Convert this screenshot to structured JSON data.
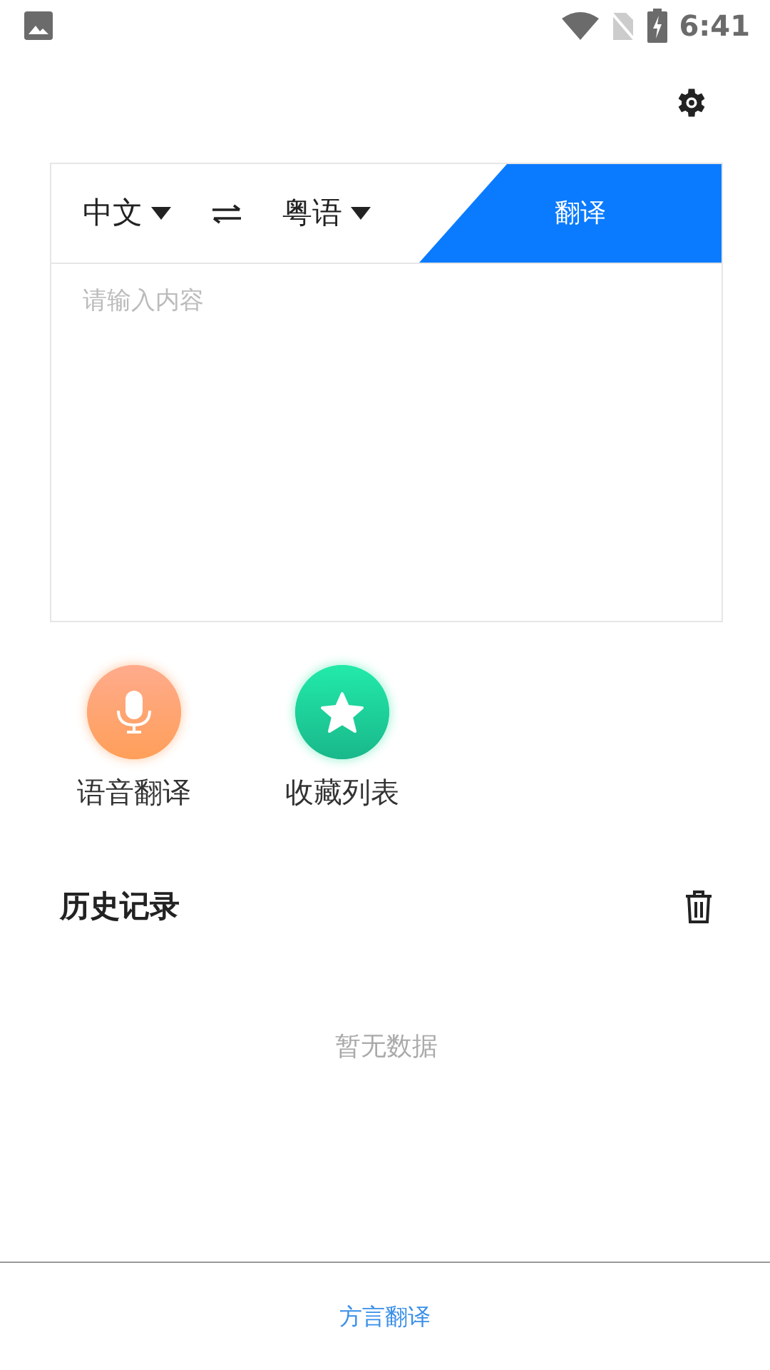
{
  "status_bar": {
    "time": "6:41"
  },
  "translator": {
    "source_language": "中文",
    "target_language": "粤语",
    "translate_button": "翻译",
    "input": {
      "placeholder": "请输入内容"
    }
  },
  "actions": [
    {
      "label": "语音翻译",
      "kind": "voice"
    },
    {
      "label": "收藏列表",
      "kind": "favorites"
    }
  ],
  "history": {
    "title": "历史记录",
    "empty_text": "暂无数据"
  },
  "bottom_tabs": [
    {
      "label": "方言翻译",
      "selected": true
    }
  ]
}
